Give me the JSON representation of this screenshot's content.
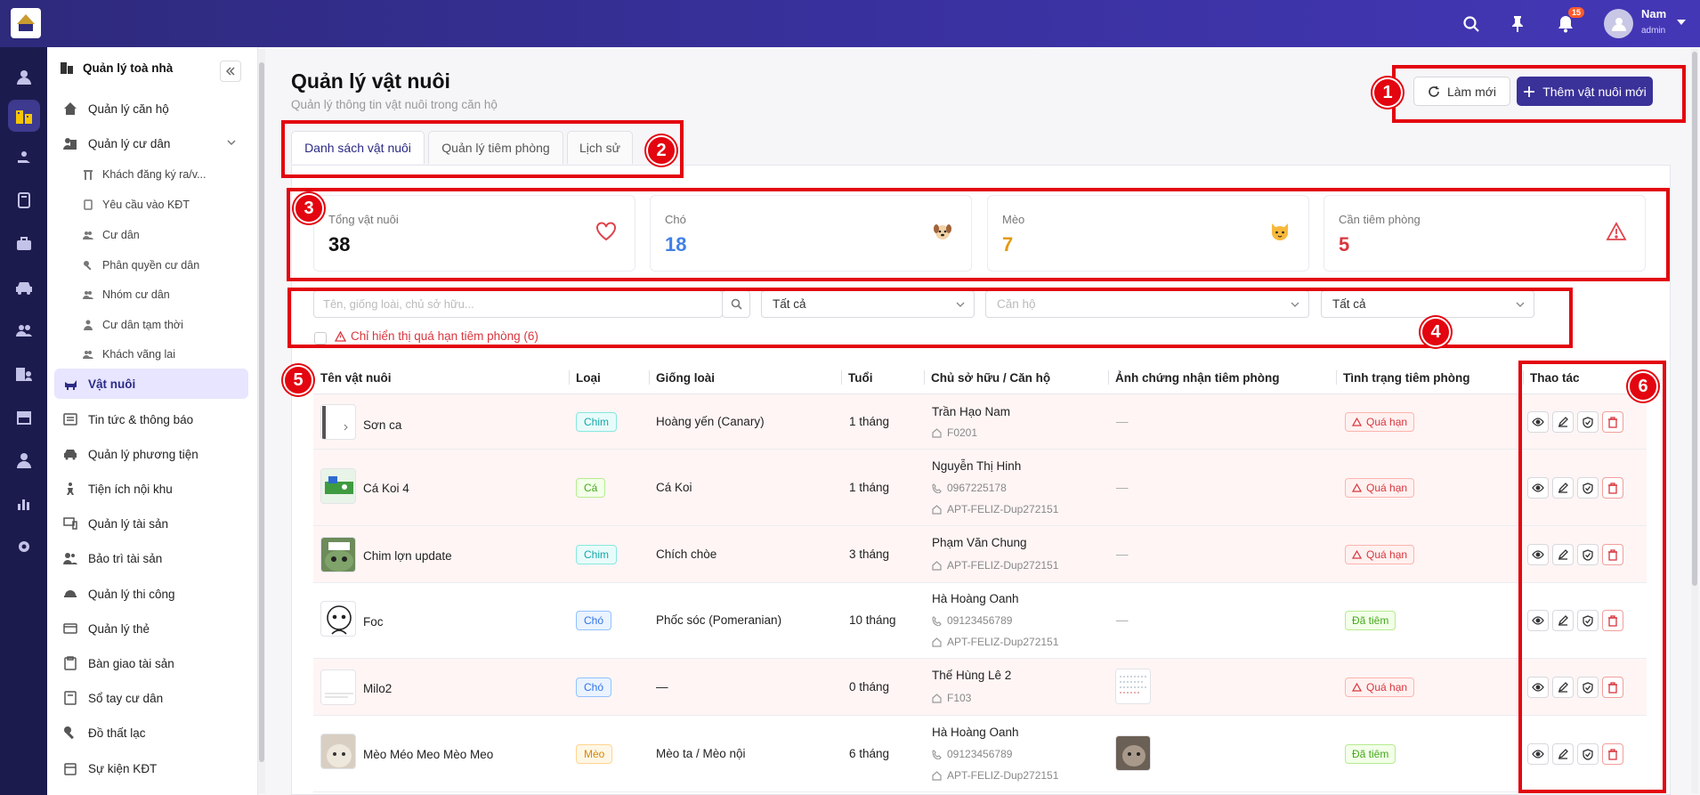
{
  "header": {
    "user_name": "Nam",
    "user_role": "admin",
    "notification_count": "15",
    "icons": [
      "search-icon",
      "pin-icon",
      "bell-icon",
      "user-icon"
    ]
  },
  "sidebar": {
    "section_title": "Quản lý toà nhà",
    "items": [
      {
        "label": "Quản lý căn hộ",
        "icon": "home-icon"
      },
      {
        "label": "Quản lý cư dân",
        "icon": "residents-icon"
      },
      {
        "label": "Vật nuôi",
        "icon": "pet-icon"
      },
      {
        "label": "Tin tức & thông báo",
        "icon": "news-icon"
      },
      {
        "label": "Quản lý phương tiện",
        "icon": "car-icon"
      },
      {
        "label": "Tiện ích nội khu",
        "icon": "amenity-icon"
      },
      {
        "label": "Quản lý tài sản",
        "icon": "asset-icon"
      },
      {
        "label": "Bảo trì tài sản",
        "icon": "maintenance-icon"
      },
      {
        "label": "Quản lý thi công",
        "icon": "construction-icon"
      },
      {
        "label": "Quản lý thẻ",
        "icon": "card-icon"
      },
      {
        "label": "Bàn giao tài sản",
        "icon": "handover-icon"
      },
      {
        "label": "Sổ tay cư dân",
        "icon": "handbook-icon"
      },
      {
        "label": "Đồ thất lạc",
        "icon": "lost-icon"
      },
      {
        "label": "Sự kiện KĐT",
        "icon": "event-icon"
      }
    ],
    "sub_items": [
      {
        "label": "Khách đăng ký ra/v..."
      },
      {
        "label": "Yêu cầu vào KĐT"
      },
      {
        "label": "Cư dân"
      },
      {
        "label": "Phân quyền cư dân"
      },
      {
        "label": "Nhóm cư dân"
      },
      {
        "label": "Cư dân tạm thời"
      },
      {
        "label": "Khách vãng lai"
      }
    ]
  },
  "page": {
    "title": "Quản lý vật nuôi",
    "subtitle": "Quản lý thông tin vật nuôi trong căn hộ",
    "refresh_label": "Làm mới",
    "add_label": "Thêm vật nuôi mới"
  },
  "tabs": [
    {
      "label": "Danh sách vật nuôi",
      "active": true
    },
    {
      "label": "Quản lý tiêm phòng"
    },
    {
      "label": "Lịch sử"
    }
  ],
  "stats": [
    {
      "label": "Tổng vật nuôi",
      "value": "38",
      "color": "#111111",
      "icon": "heart-icon"
    },
    {
      "label": "Chó",
      "value": "18",
      "color": "#3f7fe8",
      "icon": "dog-icon"
    },
    {
      "label": "Mèo",
      "value": "7",
      "color": "#e59a14",
      "icon": "cat-icon"
    },
    {
      "label": "Cần tiêm phòng",
      "value": "5",
      "color": "#d9363e",
      "icon": "warning-icon"
    }
  ],
  "filters": {
    "search_placeholder": "Tên, giống loài, chủ sở hữu...",
    "type_select": "Tất cả",
    "apartment_placeholder": "Căn hộ",
    "status_select": "Tất cả",
    "overdue_label": "Chỉ hiển thị quá hạn tiêm phòng (6)"
  },
  "table": {
    "columns": [
      "Tên vật nuôi",
      "Loại",
      "Giống loài",
      "Tuổi",
      "Chủ sở hữu / Căn hộ",
      "Ảnh chứng nhận tiêm phòng",
      "Tình trạng tiêm phòng",
      "Thao tác"
    ],
    "rows": [
      {
        "name": "Sơn ca",
        "type": "Chim",
        "breed": "Hoàng yến (Canary)",
        "age": "1 tháng",
        "owner": "Trần Hạo Nam",
        "phone": "",
        "apt": "F0201",
        "cert": "—",
        "status": "Quá hạn",
        "overdue": true
      },
      {
        "name": "Cá Koi 4",
        "type": "Cá",
        "breed": "Cá Koi",
        "age": "1 tháng",
        "owner": "Nguyễn Thị Hinh",
        "phone": "0967225178",
        "apt": "APT-FELIZ-Dup272151",
        "cert": "—",
        "status": "Quá hạn",
        "overdue": true
      },
      {
        "name": "Chim lợn update",
        "type": "Chim",
        "breed": "Chích chòe",
        "age": "3 tháng",
        "owner": "Phạm Văn Chung",
        "phone": "",
        "apt": "APT-FELIZ-Dup272151",
        "cert": "—",
        "status": "Quá hạn",
        "overdue": true
      },
      {
        "name": "Foc",
        "type": "Chó",
        "breed": "Phốc sóc (Pomeranian)",
        "age": "10 tháng",
        "owner": "Hà Hoàng Oanh",
        "phone": "09123456789",
        "apt": "APT-FELIZ-Dup272151",
        "cert": "—",
        "status": "Đã tiêm",
        "overdue": false
      },
      {
        "name": "Milo2",
        "type": "Chó",
        "breed": "—",
        "age": "0 tháng",
        "owner": "Thế Hùng Lê 2",
        "phone": "",
        "apt": "F103",
        "cert": "",
        "status": "Quá hạn",
        "overdue": true
      },
      {
        "name": "Mèo Méo Meo Mèo Meo",
        "type": "Mèo",
        "breed": "Mèo ta / Mèo nội",
        "age": "6 tháng",
        "owner": "Hà Hoàng Oanh",
        "phone": "09123456789",
        "apt": "APT-FELIZ-Dup272151",
        "cert": "",
        "status": "Đã tiêm",
        "overdue": false
      }
    ]
  },
  "annotations": [
    "1",
    "2",
    "3",
    "4",
    "5",
    "6"
  ]
}
